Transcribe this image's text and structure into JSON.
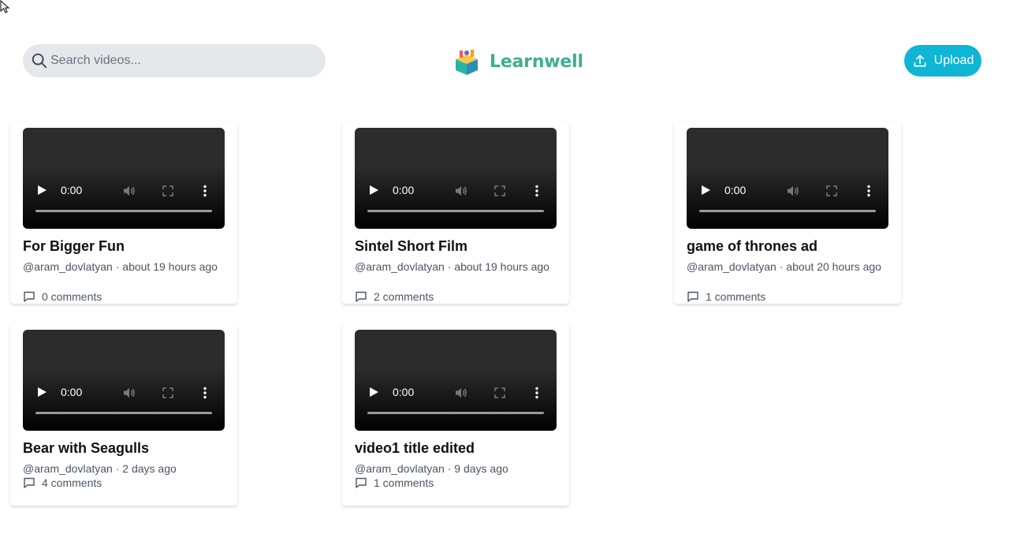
{
  "header": {
    "search_placeholder": "Search videos...",
    "logo_text": "Learnwell",
    "upload_label": "Upload"
  },
  "colors": {
    "accent": "#0fb5d4",
    "logo": "#3fae8f",
    "search_bg": "#e5e7eb"
  },
  "videos": [
    {
      "title": "For Bigger Fun",
      "author": "@aram_dovlatyan",
      "separator": "·",
      "age": "about 19 hours ago",
      "comments": "0 comments",
      "time": "0:00"
    },
    {
      "title": "Sintel Short Film",
      "author": "@aram_dovlatyan",
      "separator": "·",
      "age": "about 19 hours ago",
      "comments": "2 comments",
      "time": "0:00"
    },
    {
      "title": "game of thrones ad",
      "author": "@aram_dovlatyan",
      "separator": "·",
      "age": "about 20 hours ago",
      "comments": "1 comments",
      "time": "0:00"
    },
    {
      "title": "Bear with Seagulls",
      "author": "@aram_dovlatyan",
      "separator": "·",
      "age": "2 days ago",
      "comments": "4 comments",
      "time": "0:00"
    },
    {
      "title": "video1 title edited",
      "author": "@aram_dovlatyan",
      "separator": "·",
      "age": "9 days ago",
      "comments": "1 comments",
      "time": "0:00"
    }
  ]
}
